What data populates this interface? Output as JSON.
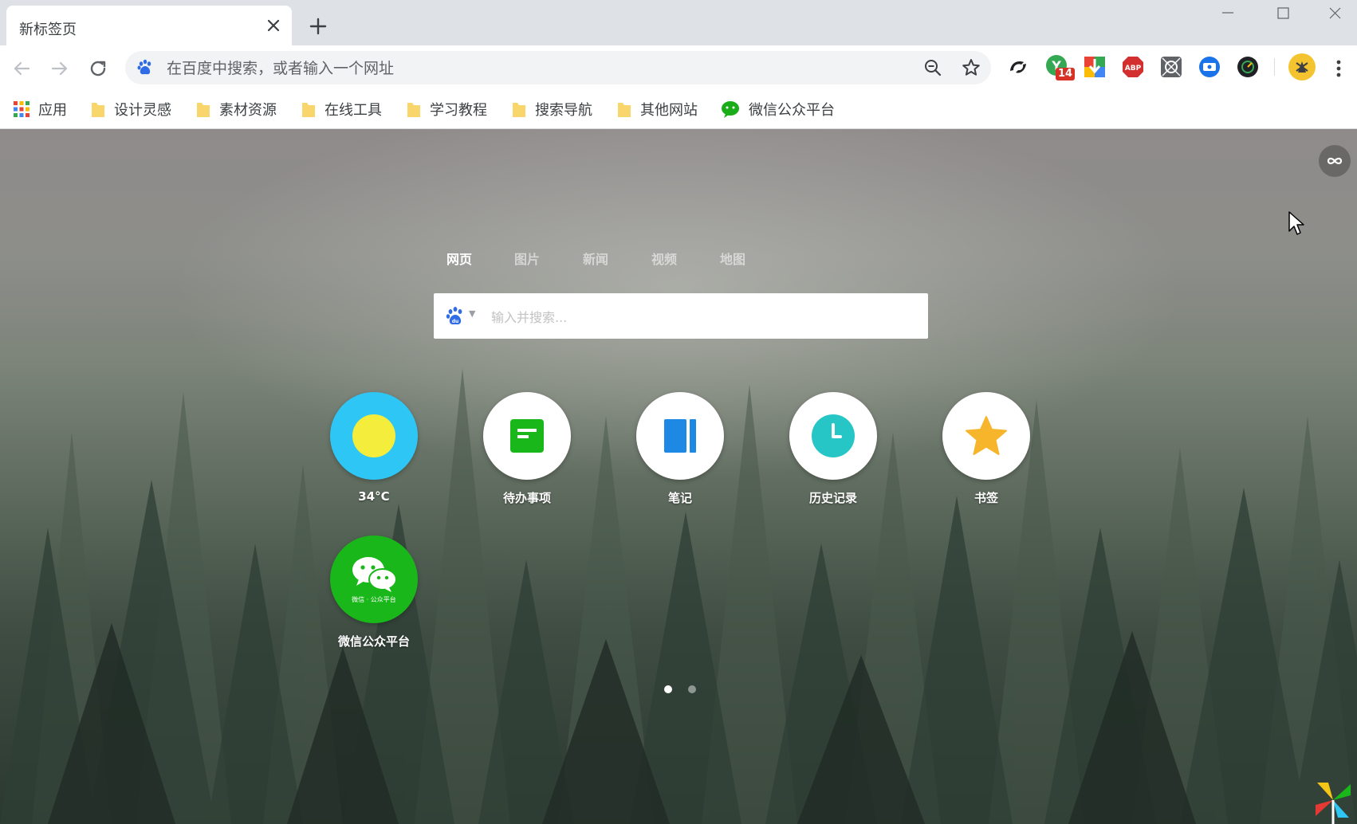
{
  "tab": {
    "title": "新标签页"
  },
  "omnibox": {
    "placeholder": "在百度中搜索，或者输入一个网址"
  },
  "extensions": {
    "badge_count": "14"
  },
  "bookmarks": [
    {
      "label": "应用",
      "icon": "apps-grid-icon"
    },
    {
      "label": "设计灵感",
      "icon": "folder-icon"
    },
    {
      "label": "素材资源",
      "icon": "folder-icon"
    },
    {
      "label": "在线工具",
      "icon": "folder-icon"
    },
    {
      "label": "学习教程",
      "icon": "folder-icon"
    },
    {
      "label": "搜索导航",
      "icon": "folder-icon"
    },
    {
      "label": "其他网站",
      "icon": "folder-icon"
    },
    {
      "label": "微信公众平台",
      "icon": "wechat-icon"
    }
  ],
  "search": {
    "tabs": [
      "网页",
      "图片",
      "新闻",
      "视频",
      "地图"
    ],
    "active_tab": "网页",
    "placeholder": "输入并搜索..."
  },
  "apps": [
    {
      "label": "34°C",
      "icon": "weather-sun-icon",
      "bg": "#2ec6f5"
    },
    {
      "label": "待办事项",
      "icon": "todo-icon",
      "bg": "#ffffff"
    },
    {
      "label": "笔记",
      "icon": "notebook-icon",
      "bg": "#ffffff"
    },
    {
      "label": "历史记录",
      "icon": "history-clock-icon",
      "bg": "#ffffff"
    },
    {
      "label": "书签",
      "icon": "bookmark-star-icon",
      "bg": "#ffffff"
    },
    {
      "label": "微信公众平台",
      "icon": "wechat-mp-icon",
      "bg": "#1ab71a",
      "sublabel": "微信 · 公众平台"
    }
  ],
  "pager": {
    "pages": 2,
    "current": 1
  },
  "colors": {
    "accent_green": "#1ab71a",
    "weather_blue": "#2ec6f5",
    "sun_yellow": "#f5ed3c"
  }
}
